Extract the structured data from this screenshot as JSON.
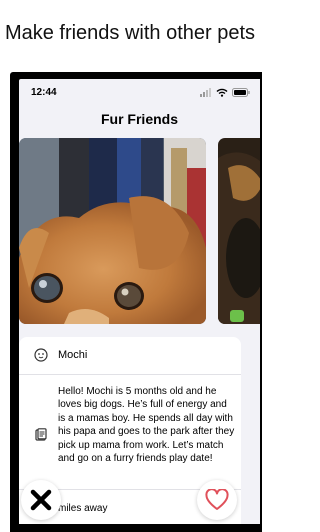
{
  "headline": "Make friends with other pets",
  "status_bar": {
    "time": "12:44"
  },
  "nav": {
    "title": "Fur Friends"
  },
  "profile": {
    "name": "Mochi",
    "bio": "Hello! Mochi is 5 months old and he loves big dogs. He’s full of energy and is a mamas boy. He spends all day with his papa and goes to the park after they pick up mama from work. Let’s match and go on a furry friends play date!",
    "distance": "miles away"
  },
  "icons": {
    "name_row": "paw-icon",
    "bio_row": "document-icon",
    "pass": "close-icon",
    "like": "heart-icon"
  },
  "colors": {
    "like": "#e0505a",
    "pass": "#000000",
    "background": "#f2f2f7"
  }
}
